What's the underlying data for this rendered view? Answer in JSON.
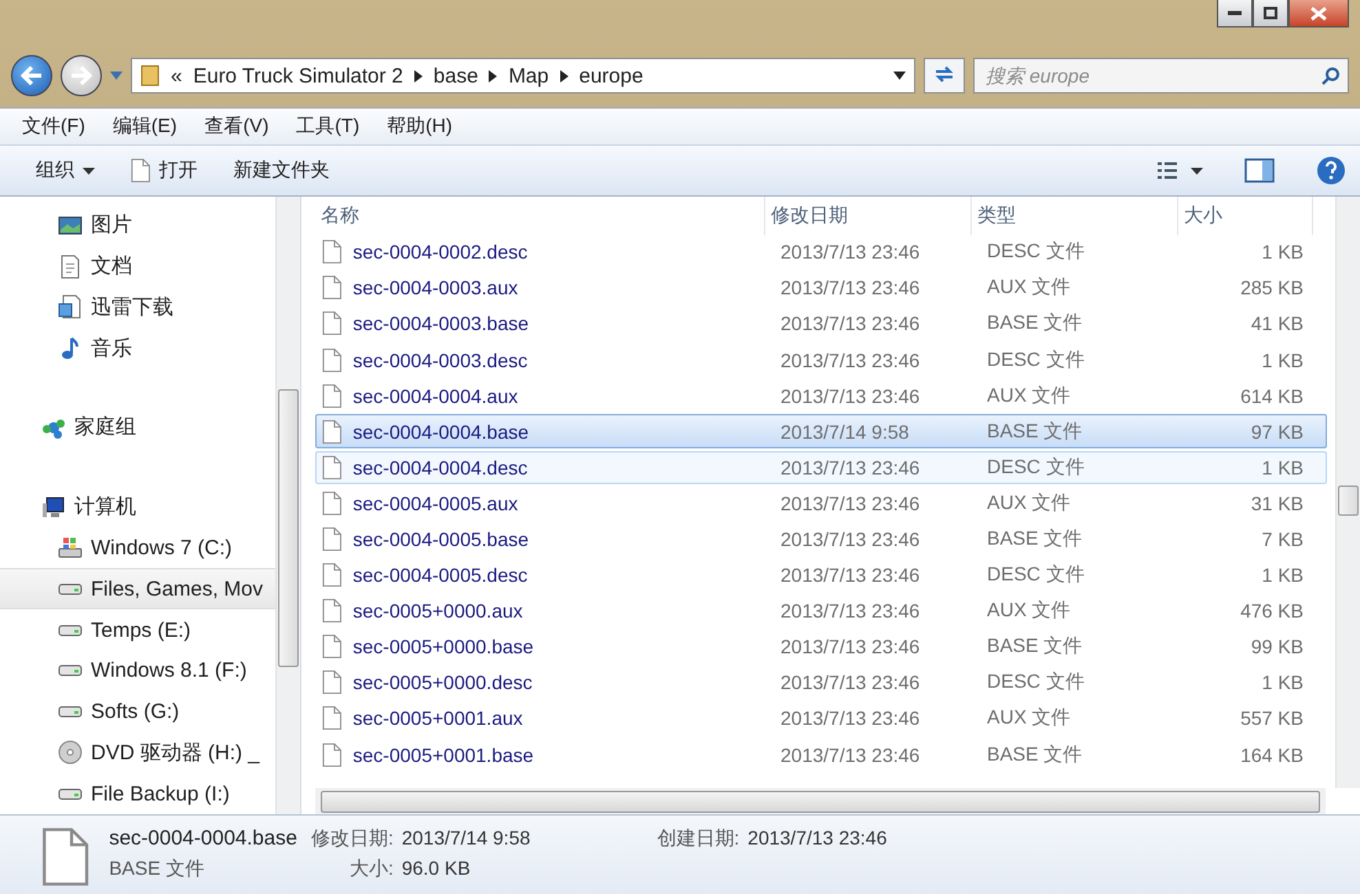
{
  "address": {
    "overflow": "«",
    "segments": [
      "Euro Truck Simulator 2",
      "base",
      "Map",
      "europe"
    ]
  },
  "search": {
    "placeholder": "搜索 europe"
  },
  "menu": [
    "文件(F)",
    "编辑(E)",
    "查看(V)",
    "工具(T)",
    "帮助(H)"
  ],
  "toolbar": {
    "organize": "组织",
    "open": "打开",
    "new_folder": "新建文件夹"
  },
  "sidebar": {
    "items": [
      {
        "label": "图片",
        "kind": "pictures",
        "selected": false
      },
      {
        "label": "文档",
        "kind": "documents",
        "selected": false
      },
      {
        "label": "迅雷下载",
        "kind": "downloads",
        "selected": false
      },
      {
        "label": "音乐",
        "kind": "music",
        "selected": false
      },
      {
        "label": "家庭组",
        "kind": "homegroup",
        "selected": false,
        "gap": true
      },
      {
        "label": "计算机",
        "kind": "computer",
        "selected": false,
        "gap": true,
        "children": [
          {
            "label": "Windows 7 (C:)",
            "kind": "system",
            "selected": false
          },
          {
            "label": "Files, Games, Mov",
            "kind": "drive",
            "selected": true
          },
          {
            "label": "Temps (E:)",
            "kind": "drive",
            "selected": false
          },
          {
            "label": "Windows 8.1 (F:)",
            "kind": "drive",
            "selected": false
          },
          {
            "label": "Softs (G:)",
            "kind": "drive",
            "selected": false
          },
          {
            "label": "DVD 驱动器 (H:) _",
            "kind": "dvd",
            "selected": false
          },
          {
            "label": "File Backup (I:)",
            "kind": "drive",
            "selected": false
          }
        ]
      }
    ]
  },
  "table": {
    "columns": [
      "名称",
      "修改日期",
      "类型",
      "大小"
    ],
    "rows": [
      {
        "name": "sec-0004-0002.desc",
        "date": "2013/7/13 23:46",
        "type": "DESC 文件",
        "size": "1 KB",
        "selected": false,
        "hovered": false
      },
      {
        "name": "sec-0004-0003.aux",
        "date": "2013/7/13 23:46",
        "type": "AUX 文件",
        "size": "285 KB",
        "selected": false,
        "hovered": false
      },
      {
        "name": "sec-0004-0003.base",
        "date": "2013/7/13 23:46",
        "type": "BASE 文件",
        "size": "41 KB",
        "selected": false,
        "hovered": false
      },
      {
        "name": "sec-0004-0003.desc",
        "date": "2013/7/13 23:46",
        "type": "DESC 文件",
        "size": "1 KB",
        "selected": false,
        "hovered": false
      },
      {
        "name": "sec-0004-0004.aux",
        "date": "2013/7/13 23:46",
        "type": "AUX 文件",
        "size": "614 KB",
        "selected": false,
        "hovered": false
      },
      {
        "name": "sec-0004-0004.base",
        "date": "2013/7/14 9:58",
        "type": "BASE 文件",
        "size": "97 KB",
        "selected": true,
        "hovered": false
      },
      {
        "name": "sec-0004-0004.desc",
        "date": "2013/7/13 23:46",
        "type": "DESC 文件",
        "size": "1 KB",
        "selected": false,
        "hovered": true
      },
      {
        "name": "sec-0004-0005.aux",
        "date": "2013/7/13 23:46",
        "type": "AUX 文件",
        "size": "31 KB",
        "selected": false,
        "hovered": false
      },
      {
        "name": "sec-0004-0005.base",
        "date": "2013/7/13 23:46",
        "type": "BASE 文件",
        "size": "7 KB",
        "selected": false,
        "hovered": false
      },
      {
        "name": "sec-0004-0005.desc",
        "date": "2013/7/13 23:46",
        "type": "DESC 文件",
        "size": "1 KB",
        "selected": false,
        "hovered": false
      },
      {
        "name": "sec-0005+0000.aux",
        "date": "2013/7/13 23:46",
        "type": "AUX 文件",
        "size": "476 KB",
        "selected": false,
        "hovered": false
      },
      {
        "name": "sec-0005+0000.base",
        "date": "2013/7/13 23:46",
        "type": "BASE 文件",
        "size": "99 KB",
        "selected": false,
        "hovered": false
      },
      {
        "name": "sec-0005+0000.desc",
        "date": "2013/7/13 23:46",
        "type": "DESC 文件",
        "size": "1 KB",
        "selected": false,
        "hovered": false
      },
      {
        "name": "sec-0005+0001.aux",
        "date": "2013/7/13 23:46",
        "type": "AUX 文件",
        "size": "557 KB",
        "selected": false,
        "hovered": false
      },
      {
        "name": "sec-0005+0001.base",
        "date": "2013/7/13 23:46",
        "type": "BASE 文件",
        "size": "164 KB",
        "selected": false,
        "hovered": false
      }
    ]
  },
  "details": {
    "name": "sec-0004-0004.base",
    "type": "BASE 文件",
    "modified_label": "修改日期:",
    "modified": "2013/7/14 9:58",
    "size_label": "大小:",
    "size": "96.0 KB",
    "created_label": "创建日期:",
    "created": "2013/7/13 23:46"
  }
}
